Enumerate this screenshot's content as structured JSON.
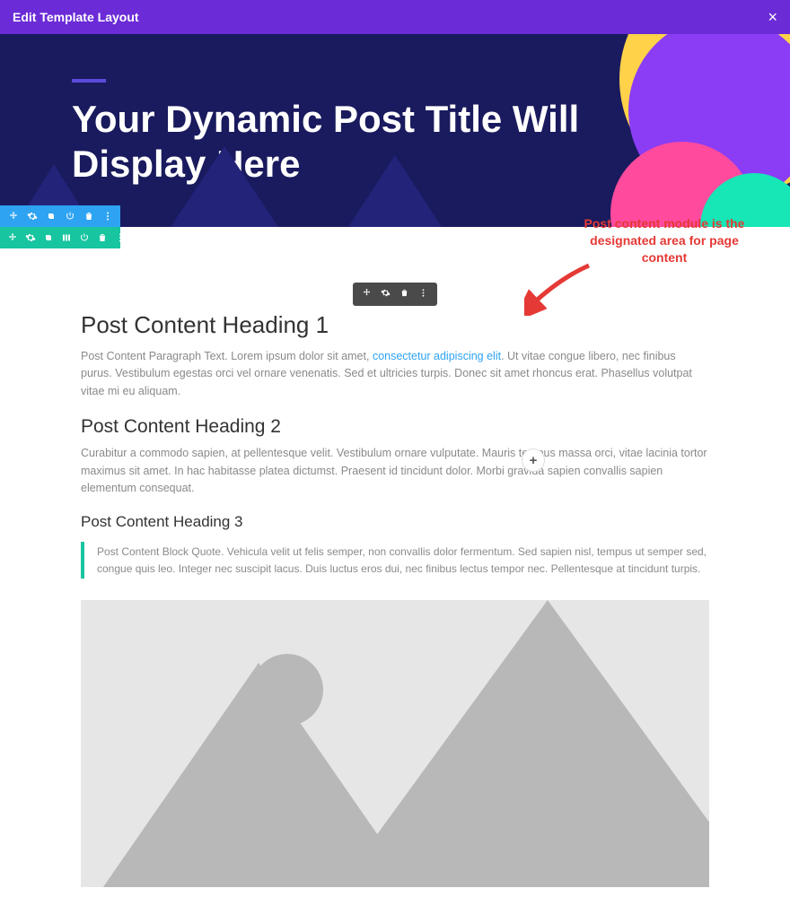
{
  "topbar": {
    "title": "Edit Template Layout"
  },
  "hero": {
    "title": "Your Dynamic Post Title Will Display Here"
  },
  "annotation": {
    "text": "Post content module is the designated area for page content"
  },
  "content": {
    "heading1": "Post Content Heading 1",
    "p1_before": "Post Content Paragraph Text. Lorem ipsum dolor sit amet, ",
    "p1_link": "consectetur adipiscing elit",
    "p1_after": ". Ut vitae congue libero, nec finibus purus. Vestibulum egestas orci vel ornare venenatis. Sed et ultricies turpis. Donec sit amet rhoncus erat. Phasellus volutpat vitae mi eu aliquam.",
    "heading2": "Post Content Heading 2",
    "p2": "Curabitur a commodo sapien, at pellentesque velit. Vestibulum ornare vulputate. Mauris tempus massa orci, vitae lacinia tortor maximus sit amet. In hac habitasse platea dictumst. Praesent id tincidunt dolor. Morbi gravida sapien convallis sapien elementum consequat.",
    "heading3": "Post Content Heading 3",
    "quote": "Post Content Block Quote. Vehicula velit ut felis semper, non convallis dolor fermentum. Sed sapien nisl, tempus ut semper sed, congue quis leo. Integer nec suscipit lacus. Duis luctus eros dui, nec finibus lectus tempor nec. Pellentesque at tincidunt turpis."
  }
}
